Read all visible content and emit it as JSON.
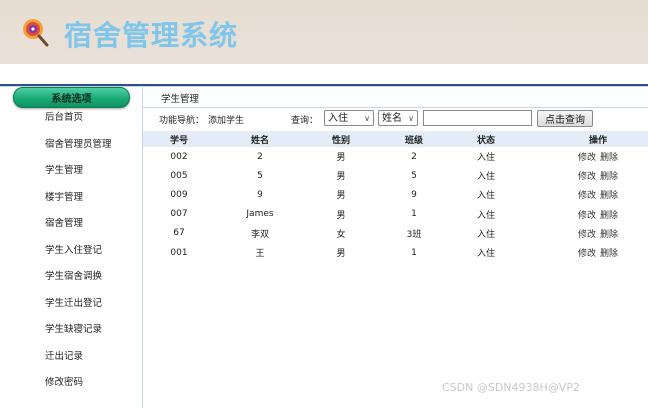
{
  "app": {
    "title": "宿舍管理系统"
  },
  "sidebar": {
    "header": "系统选项",
    "items": [
      {
        "label": "后台首页"
      },
      {
        "label": "宿舍管理员管理"
      },
      {
        "label": "学生管理"
      },
      {
        "label": "楼宇管理"
      },
      {
        "label": "宿舍管理"
      },
      {
        "label": "学生入住登记"
      },
      {
        "label": "学生宿舍调换"
      },
      {
        "label": "学生迁出登记"
      },
      {
        "label": "学生缺寝记录"
      },
      {
        "label": "迁出记录"
      },
      {
        "label": "修改密码"
      }
    ]
  },
  "main": {
    "breadcrumb": "学生管理",
    "toolbar": {
      "nav_label": "功能导航：",
      "add_link": "添加学生",
      "query_label": "查询：",
      "status_select": "入住",
      "field_select": "姓名",
      "search_value": "",
      "search_button": "点击查询"
    },
    "table": {
      "headers": [
        "学号",
        "姓名",
        "性别",
        "班级",
        "状态",
        "操作"
      ],
      "rows": [
        {
          "id": "002",
          "name": "2",
          "gender": "男",
          "class": "2",
          "status": "入住",
          "edit": "修改",
          "delete": "删除"
        },
        {
          "id": "005",
          "name": "5",
          "gender": "男",
          "class": "5",
          "status": "入住",
          "edit": "修改",
          "delete": "删除"
        },
        {
          "id": "009",
          "name": "9",
          "gender": "男",
          "class": "9",
          "status": "入住",
          "edit": "修改",
          "delete": "删除"
        },
        {
          "id": "007",
          "name": "James",
          "gender": "男",
          "class": "1",
          "status": "入住",
          "edit": "修改",
          "delete": "删除"
        },
        {
          "id": "67",
          "name": "李双",
          "gender": "女",
          "class": "3班",
          "status": "入住",
          "edit": "修改",
          "delete": "删除"
        },
        {
          "id": "001",
          "name": "王",
          "gender": "男",
          "class": "1",
          "status": "入住",
          "edit": "修改",
          "delete": "删除"
        }
      ]
    }
  },
  "watermark": "CSDN @SDN4938H@VP2",
  "colors": {
    "title": "#7fc6ea",
    "header_bg": "#e6dcd2",
    "accent_line": "#2d4f8f",
    "table_head": "#e3ecf7",
    "side_button": "#17a873"
  }
}
